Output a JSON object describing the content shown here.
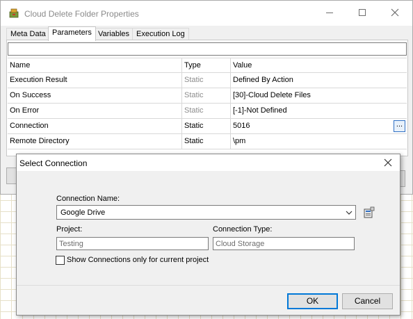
{
  "window": {
    "title": "Cloud Delete Folder Properties",
    "icon": "cabinet-icon"
  },
  "tabs": [
    {
      "label": "Meta Data"
    },
    {
      "label": "Parameters",
      "active": true
    },
    {
      "label": "Variables"
    },
    {
      "label": "Execution Log"
    }
  ],
  "grid": {
    "headers": {
      "name": "Name",
      "type": "Type",
      "value": "Value"
    },
    "rows": [
      {
        "name": "Execution Result",
        "type": "Static",
        "value": "Defined By Action"
      },
      {
        "name": "On Success",
        "type": "Static",
        "value": "[30]-Cloud Delete Files"
      },
      {
        "name": "On Error",
        "type": "Static",
        "value": "[-1]-Not Defined"
      },
      {
        "name": "Connection",
        "type": "Static",
        "value": "5016",
        "button": "..."
      },
      {
        "name": "Remote Directory",
        "type": "Static",
        "value": "\\pm"
      }
    ]
  },
  "dialog": {
    "title": "Select Connection",
    "connection_name_label": "Connection Name:",
    "connection_name_value": "Google Drive",
    "project_label": "Project:",
    "project_value": "Testing",
    "connection_type_label": "Connection Type:",
    "connection_type_value": "Cloud Storage",
    "checkbox_label": "Show Connections only for current project",
    "checkbox_checked": false,
    "ok_label": "OK",
    "cancel_label": "Cancel"
  },
  "colors": {
    "accent": "#0078d7",
    "window_bg": "#f0f0f0",
    "grid_line": "#e6e0c8"
  }
}
